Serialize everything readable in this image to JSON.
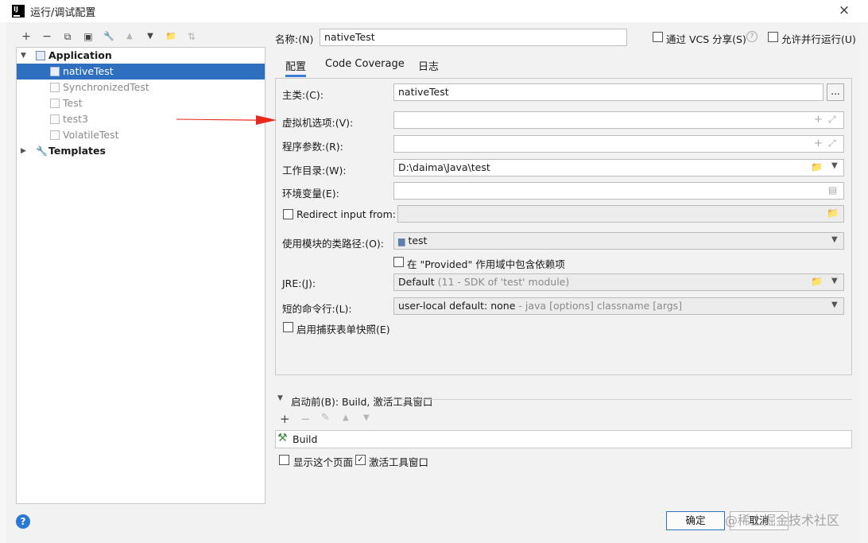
{
  "window": {
    "title": "运行/调试配置",
    "close": "×"
  },
  "left_toolbar": {
    "add": "+",
    "remove": "−",
    "copy": "⧉",
    "save": "▣",
    "edit": "🔧",
    "up": "▲",
    "down": "▼",
    "folder": "📁",
    "sort": "⇅"
  },
  "tree": {
    "application": "Application",
    "items": [
      "nativeTest",
      "SynchronizedTest",
      "Test",
      "test3",
      "VolatileTest"
    ],
    "templates": "Templates"
  },
  "header": {
    "name_label": "名称:(N)",
    "name_value": "nativeTest",
    "vcs_label": "通过 VCS 分享(S)",
    "help_glyph": "?",
    "parallel_label": "允许并行运行(U)"
  },
  "tabs": [
    "配置",
    "Code Coverage",
    "日志"
  ],
  "form": {
    "main_class_label": "主类:(C):",
    "main_class_value": "nativeTest",
    "browse": "...",
    "vm_label": "虚拟机选项:(V):",
    "vm_value": "",
    "args_label": "程序参数:(R):",
    "args_value": "",
    "workdir_label": "工作目录:(W):",
    "workdir_value": "D:\\daima\\Java\\test",
    "env_label": "环境变量(E):",
    "env_value": "",
    "redirect_label": "Redirect input from:",
    "classpath_label": "使用模块的类路径:(O):",
    "classpath_value": "test",
    "provided_label": "在 \"Provided\" 作用域中包含依赖项",
    "jre_label": "JRE:(J):",
    "jre_value": "Default",
    "jre_hint": "(11 - SDK of 'test' module)",
    "shorten_label": "短的命令行:(L):",
    "shorten_value": "user-local default: none",
    "shorten_hint": "- java [options] classname [args]",
    "snapshot_label": "启用捕获表单快照(E)"
  },
  "before_launch": {
    "header": "启动前(B): Build, 激活工具窗口",
    "add": "+",
    "remove": "−",
    "edit": "✎",
    "up": "▲",
    "down": "▼",
    "build_item": "Build",
    "show_page_label": "显示这个页面",
    "activate_label": "激活工具窗口",
    "activate_checked": "✓"
  },
  "footer": {
    "help": "?",
    "ok": "确定",
    "cancel": "取消",
    "watermark": "@稀土掘金技术社区"
  },
  "colors": {
    "selection": "#2f6fc0",
    "arrow": "#e8281d",
    "tab_underline": "#3b7dd8"
  }
}
